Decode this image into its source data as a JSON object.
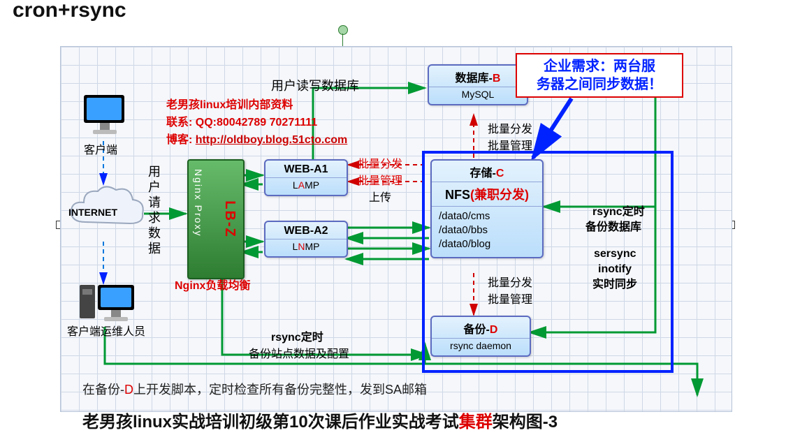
{
  "topTitle": "cron+rsync",
  "clientLabel": "客户端",
  "internetLabel": "INTERNET",
  "verticalUserReq": "用户请求数据",
  "opsClient": "客户端运维人员",
  "contact": {
    "line1": "老男孩linux培训内部资料",
    "line2a": "联系: QQ:",
    "line2b": "80042789 70271111",
    "line3a": "博客: ",
    "line3b": "http://oldboy.blog.51cto.com"
  },
  "nginx": {
    "proxy": "Nginx Proxy",
    "lbz": "LB-Z",
    "balance": "Nginx负载均衡"
  },
  "webA1": {
    "name": "WEB-A1",
    "stack": "LAMP",
    "stackPre": "L",
    "stackMid": "A",
    "stackPost": "MP"
  },
  "webA2": {
    "name": "WEB-A2",
    "stack": "LNMP",
    "stackPre": "L",
    "stackMid": "N",
    "stackPost": "MP"
  },
  "db": {
    "name1": "数据库-",
    "nameR": "B",
    "engine": "MySQL"
  },
  "storage": {
    "name1": "存储-",
    "nameR": "C",
    "nfsA": "NFS",
    "nfsB": "(兼职分发)",
    "paths": [
      "/data0/cms",
      "/data0/bbs",
      "/data0/blog"
    ]
  },
  "backup": {
    "name1": "备份-",
    "nameR": "D",
    "daemon": "rsync daemon"
  },
  "arrows": {
    "userRW": "用户读写数据库",
    "batchDist": "批量分发",
    "batchMgmt": "批量管理",
    "upload": "上传",
    "rsyncTimed": "rsync定时",
    "backupSiteCfg": "备份站点数据及配置",
    "backupDbLine1": "rsync定时",
    "backupDbLine2": "备份数据库",
    "sersync": "sersync",
    "inotify": "inotify",
    "realtimeSync": "实时同步"
  },
  "callout": {
    "l1": "企业需求：两台服",
    "l2": "务器之间同步数据！"
  },
  "footer1a": "在备份-",
  "footer1b": "D",
  "footer1c": "上开发脚本，定时检查所有备份完整性，发到SA邮箱",
  "footer2a": "老男孩linux实战培训初级第10次课后作业实战考试",
  "footer2b": "集群",
  "footer2c": "架构图-3"
}
